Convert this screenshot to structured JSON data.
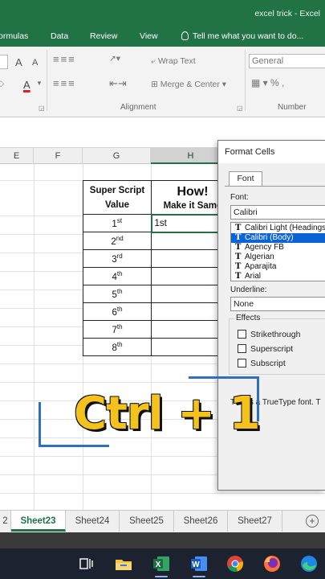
{
  "window": {
    "title": "excel trick - Excel"
  },
  "ribbon_tabs": [
    "ormulas",
    "Data",
    "Review",
    "View"
  ],
  "tell_me": {
    "placeholder": "Tell me what you want to do..."
  },
  "ribbon": {
    "font_grow": "A",
    "font_shrink": "A",
    "font_color_letter": "A",
    "wrap_text": "Wrap Text",
    "merge_center": "Merge & Center",
    "number_format": "General",
    "alignment_label": "Alignment",
    "number_label": "Number"
  },
  "columns": [
    {
      "label": "E",
      "selected": false
    },
    {
      "label": "F",
      "selected": false
    },
    {
      "label": "G",
      "selected": false
    },
    {
      "label": "H",
      "selected": true
    }
  ],
  "table": {
    "header_g_line1": "Super Script",
    "header_g_line2": "Value",
    "header_h_line1": "How!",
    "header_h_line2": "Make it Same",
    "rows": [
      {
        "num": "1",
        "sup": "st",
        "h": "1st"
      },
      {
        "num": "2",
        "sup": "nd",
        "h": ""
      },
      {
        "num": "3",
        "sup": "rd",
        "h": ""
      },
      {
        "num": "4",
        "sup": "th",
        "h": ""
      },
      {
        "num": "5",
        "sup": "th",
        "h": ""
      },
      {
        "num": "6",
        "sup": "th",
        "h": ""
      },
      {
        "num": "7",
        "sup": "th",
        "h": ""
      },
      {
        "num": "8",
        "sup": "th",
        "h": ""
      }
    ]
  },
  "overlay": {
    "shortcut": "Ctrl + 1"
  },
  "dialog": {
    "title": "Format Cells",
    "tab": "Font",
    "font_label": "Font:",
    "font_value": "Calibri",
    "fonts": [
      "Calibri Light (Headings)",
      "Calibri (Body)",
      "Agency FB",
      "Algerian",
      "Aparajita",
      "Arial"
    ],
    "selected_font_index": 1,
    "underline_label": "Underline:",
    "underline_value": "None",
    "effects_label": "Effects",
    "effects": [
      "Strikethrough",
      "Superscript",
      "Subscript"
    ],
    "truetype_note": "This is a TrueType font. T"
  },
  "sheets": [
    {
      "name": "2",
      "active": false
    },
    {
      "name": "Sheet23",
      "active": true
    },
    {
      "name": "Sheet24",
      "active": false
    },
    {
      "name": "Sheet25",
      "active": false
    },
    {
      "name": "Sheet26",
      "active": false
    },
    {
      "name": "Sheet27",
      "active": false
    }
  ],
  "add_sheet": "+",
  "taskbar": [
    "task-view-icon",
    "file-explorer-icon",
    "excel-icon",
    "word-icon",
    "chrome-icon",
    "firefox-icon",
    "edge-icon"
  ],
  "colors": {
    "excel_green": "#217346",
    "accent_yellow": "#f3c21c",
    "select_blue": "#0a64d6"
  }
}
